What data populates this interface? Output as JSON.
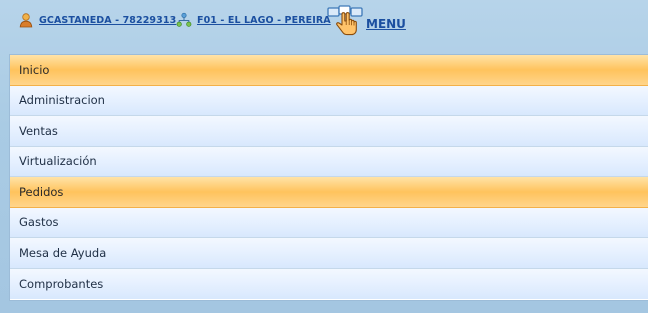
{
  "header": {
    "user_label": "GCASTANEDA - 78229313",
    "branch_label": "F01 - EL LAGO - PEREIRA",
    "menu_label": "MENU",
    "user_icon": "user-icon",
    "branch_icon": "network-icon",
    "menu_icon": "hand-pointer-menu-icon"
  },
  "menu": {
    "items": [
      {
        "label": "Inicio",
        "active": true
      },
      {
        "label": "Administracion",
        "active": false
      },
      {
        "label": "Ventas",
        "active": false
      },
      {
        "label": "Virtualización",
        "active": false
      },
      {
        "label": "Pedidos",
        "active": true
      },
      {
        "label": "Gastos",
        "active": false
      },
      {
        "label": "Mesa de Ayuda",
        "active": false
      },
      {
        "label": "Comprobantes",
        "active": false
      }
    ]
  },
  "colors": {
    "background": "#a9cbe4",
    "link": "#1b4fa0",
    "active_item": "#ffc35d",
    "item": "#e7f1ff"
  }
}
